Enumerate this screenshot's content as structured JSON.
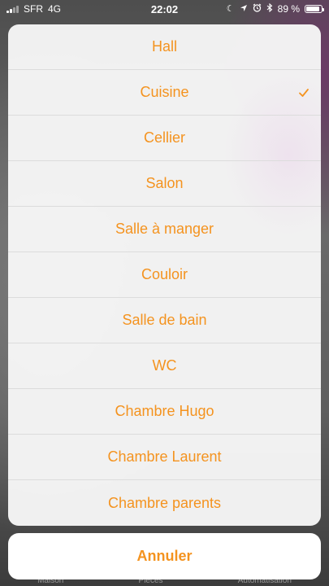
{
  "status_bar": {
    "carrier": "SFR",
    "network": "4G",
    "time": "22:02",
    "battery_text": "89 %",
    "battery_level": 0.89,
    "icons": [
      "moon-icon",
      "location-icon",
      "alarm-icon",
      "bluetooth-icon"
    ]
  },
  "sheet": {
    "options": [
      {
        "label": "Hall",
        "selected": false
      },
      {
        "label": "Cuisine",
        "selected": true
      },
      {
        "label": "Cellier",
        "selected": false
      },
      {
        "label": "Salon",
        "selected": false
      },
      {
        "label": "Salle à manger",
        "selected": false
      },
      {
        "label": "Couloir",
        "selected": false
      },
      {
        "label": "Salle de bain",
        "selected": false
      },
      {
        "label": "WC",
        "selected": false
      },
      {
        "label": "Chambre Hugo",
        "selected": false
      },
      {
        "label": "Chambre Laurent",
        "selected": false
      },
      {
        "label": "Chambre parents",
        "selected": false
      }
    ],
    "cancel_label": "Annuler"
  },
  "tab_bar": {
    "items": [
      "Maison",
      "Pièces",
      "Automatisation"
    ]
  },
  "colors": {
    "accent": "#f4931f",
    "sheet_background": "#f6f6f6",
    "separator": "#dcdcdc"
  }
}
